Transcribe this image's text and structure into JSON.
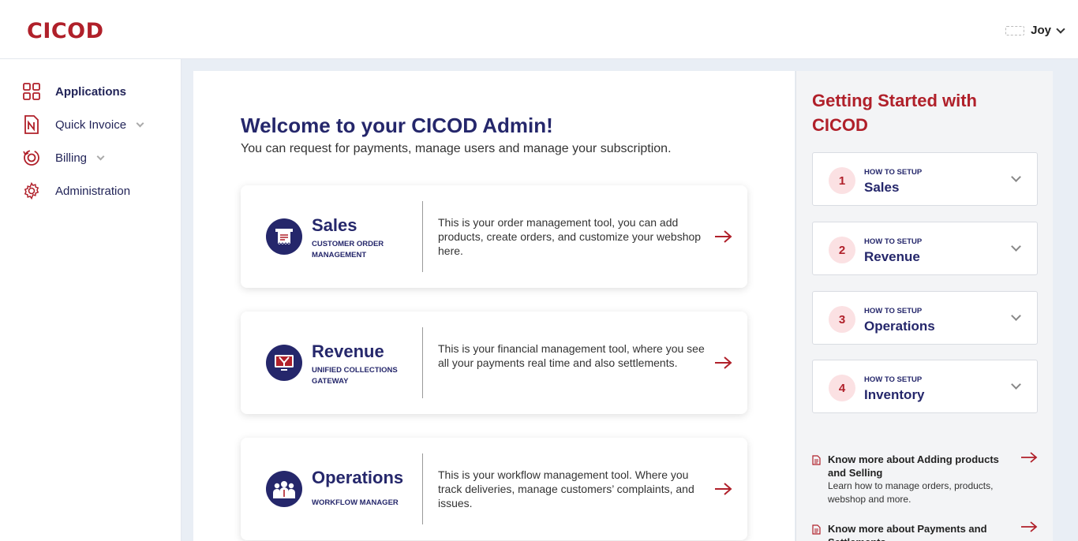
{
  "brand": {
    "logo": "CICOD",
    "accent": "#b0202a",
    "primary": "#25276b"
  },
  "user": {
    "name": "Joy"
  },
  "sidebar": {
    "items": [
      {
        "label": "Applications",
        "icon": "grid-icon",
        "active": true
      },
      {
        "label": "Quick Invoice",
        "icon": "invoice-icon",
        "expandable": true
      },
      {
        "label": "Billing",
        "icon": "billing-icon",
        "expandable": true
      },
      {
        "label": "Administration",
        "icon": "gear-icon"
      }
    ]
  },
  "main": {
    "title": "Welcome to your CICOD Admin!",
    "subtitle": "You can request for payments, manage users and manage your subscription.",
    "cards": [
      {
        "title": "Sales",
        "subtitle": "CUSTOMER ORDER MANAGEMENT",
        "description": "This is your order management tool, you can add products, create orders, and customize your webshop here.",
        "icon": "receipt-icon"
      },
      {
        "title": "Revenue",
        "subtitle": "UNIFIED COLLECTIONS GATEWAY",
        "description": "This is your financial management tool, where you see all your payments real time and also settlements.",
        "icon": "monitor-icon"
      },
      {
        "title": "Operations",
        "subtitle": "WORKFLOW MANAGER",
        "description": "This is your workflow management tool. Where you track deliveries, manage customers’ complaints, and issues.",
        "icon": "team-icon"
      }
    ]
  },
  "getting_started": {
    "title": "Getting Started with CICOD",
    "setups": [
      {
        "number": "1",
        "label": "HOW TO SETUP",
        "title": "Sales"
      },
      {
        "number": "2",
        "label": "HOW TO SETUP",
        "title": "Revenue"
      },
      {
        "number": "3",
        "label": "HOW TO SETUP",
        "title": "Operations"
      },
      {
        "number": "4",
        "label": "HOW TO SETUP",
        "title": "Inventory"
      }
    ],
    "know_more": [
      {
        "title": "Know more about Adding products and Selling",
        "description": "Learn how to manage orders, products, webshop and more."
      },
      {
        "title": "Know more about Payments and Settlements",
        "description": ""
      }
    ]
  }
}
